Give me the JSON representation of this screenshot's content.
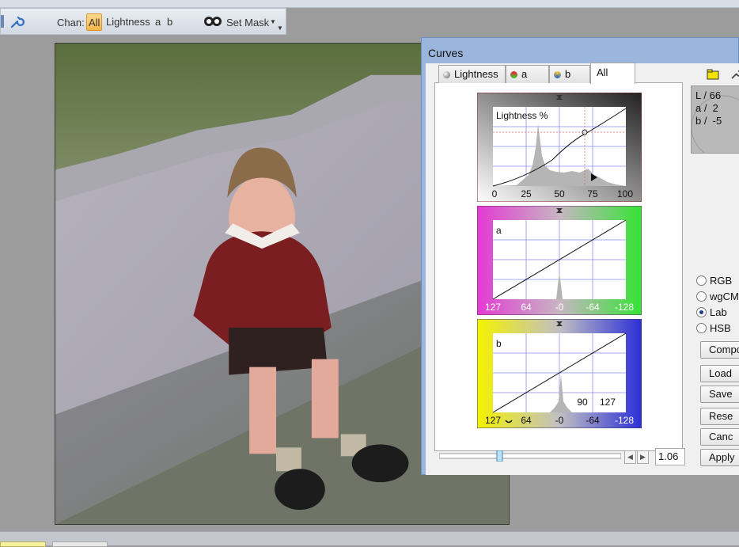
{
  "toolbar": {
    "chan_label": "Chan:",
    "channels": [
      "All",
      "Lightness",
      "a",
      "b"
    ],
    "selected_channel": "All",
    "set_mask": "Set Mask"
  },
  "curves": {
    "title": "Curves",
    "tabs": [
      "Lightness",
      "a",
      "b",
      "All"
    ],
    "active_tab": "All",
    "lightness": {
      "label": "Lightness %",
      "ticks": [
        "0",
        "25",
        "50",
        "75",
        "100"
      ],
      "marker": {
        "x": 69,
        "y": 69
      }
    },
    "a": {
      "label": "a",
      "ticks": [
        "127",
        "64",
        "-0",
        "-64",
        "-128"
      ]
    },
    "b": {
      "label": "b",
      "ticks": [
        "127",
        "64",
        "-0",
        "-64",
        "-128"
      ],
      "value_in": "90",
      "value_out": "127"
    },
    "slider_value": "1.06",
    "slider_fraction": 0.33,
    "readout": {
      "l": "L / 66",
      "a": "a /  2",
      "b": "b /  -5"
    },
    "color_modes": [
      "RGB",
      "wgCM",
      "Lab",
      "HSB"
    ],
    "selected_mode": "Lab",
    "buttons": [
      "Compo",
      "Load",
      "Save",
      "Rese",
      "Canc",
      "Apply"
    ]
  },
  "colors": {
    "accent": "#f6b647",
    "dialog_title_bar": "#9bb6dc",
    "grid": "#8d8cf0",
    "histogram": "#b5b5b5"
  }
}
